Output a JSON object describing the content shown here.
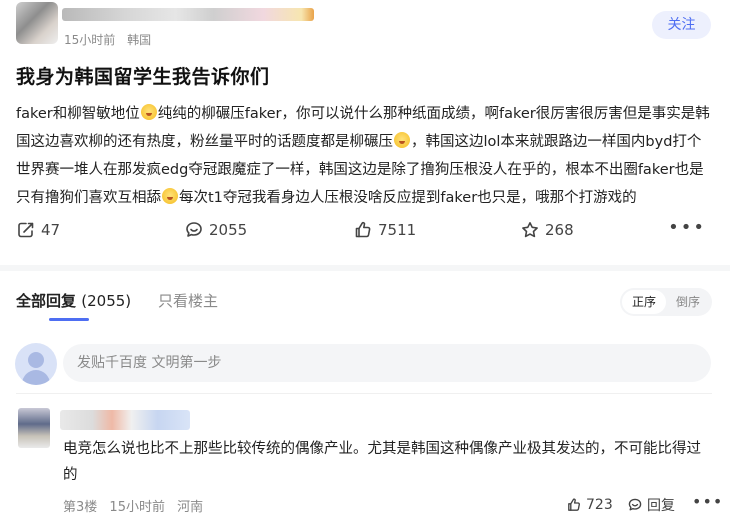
{
  "post": {
    "time": "15小时前",
    "location": "韩国",
    "follow_label": "关注",
    "title": "我身为韩国留学生我告诉你们",
    "body_segments": [
      "faker和柳智敏地位",
      "纯纯的柳碾压faker，你可以说什么那种纸面成绩，啊faker很厉害很厉害但是事实是韩国这边喜欢柳的还有热度，粉丝量平时的话题度都是柳碾压",
      "，韩国这边lol本来就跟路边一样国内byd打个世界赛一堆人在那发疯edg夺冠跟魔症了一样，韩国这边是除了撸狗压根没人在乎的，根本不出圈faker也是只有撸狗们喜欢互相舔",
      "每次t1夺冠我看身边人压根没啥反应提到faker也只是，哦那个打游戏的"
    ],
    "emoji_name": "flushed-face-emoji",
    "stats": {
      "share": "47",
      "comments": "2055",
      "likes": "7511",
      "favorites": "268"
    }
  },
  "replies": {
    "tab_all_label": "全部回复",
    "tab_all_count": "(2055)",
    "tab_op_label": "只看楼主",
    "sort_options": [
      "正序",
      "倒序"
    ],
    "sort_selected": "正序",
    "input_placeholder": "发贴千百度 文明第一步"
  },
  "comment": {
    "text": "电竞怎么说也比不上那些比较传统的偶像产业。尤其是韩国这种偶像产业极其发达的，不可能比得过的",
    "floor": "第3楼",
    "time": "15小时前",
    "location": "河南",
    "likes": "723",
    "reply_label": "回复"
  },
  "icons": {
    "share": "share-icon",
    "comment": "comment-icon",
    "like": "thumb-up-icon",
    "favorite": "star-icon",
    "more": "more-icon"
  },
  "colors": {
    "accent": "#4e6ef2",
    "follow_bg": "#edf0fd",
    "muted_text": "#8a8a8a"
  }
}
